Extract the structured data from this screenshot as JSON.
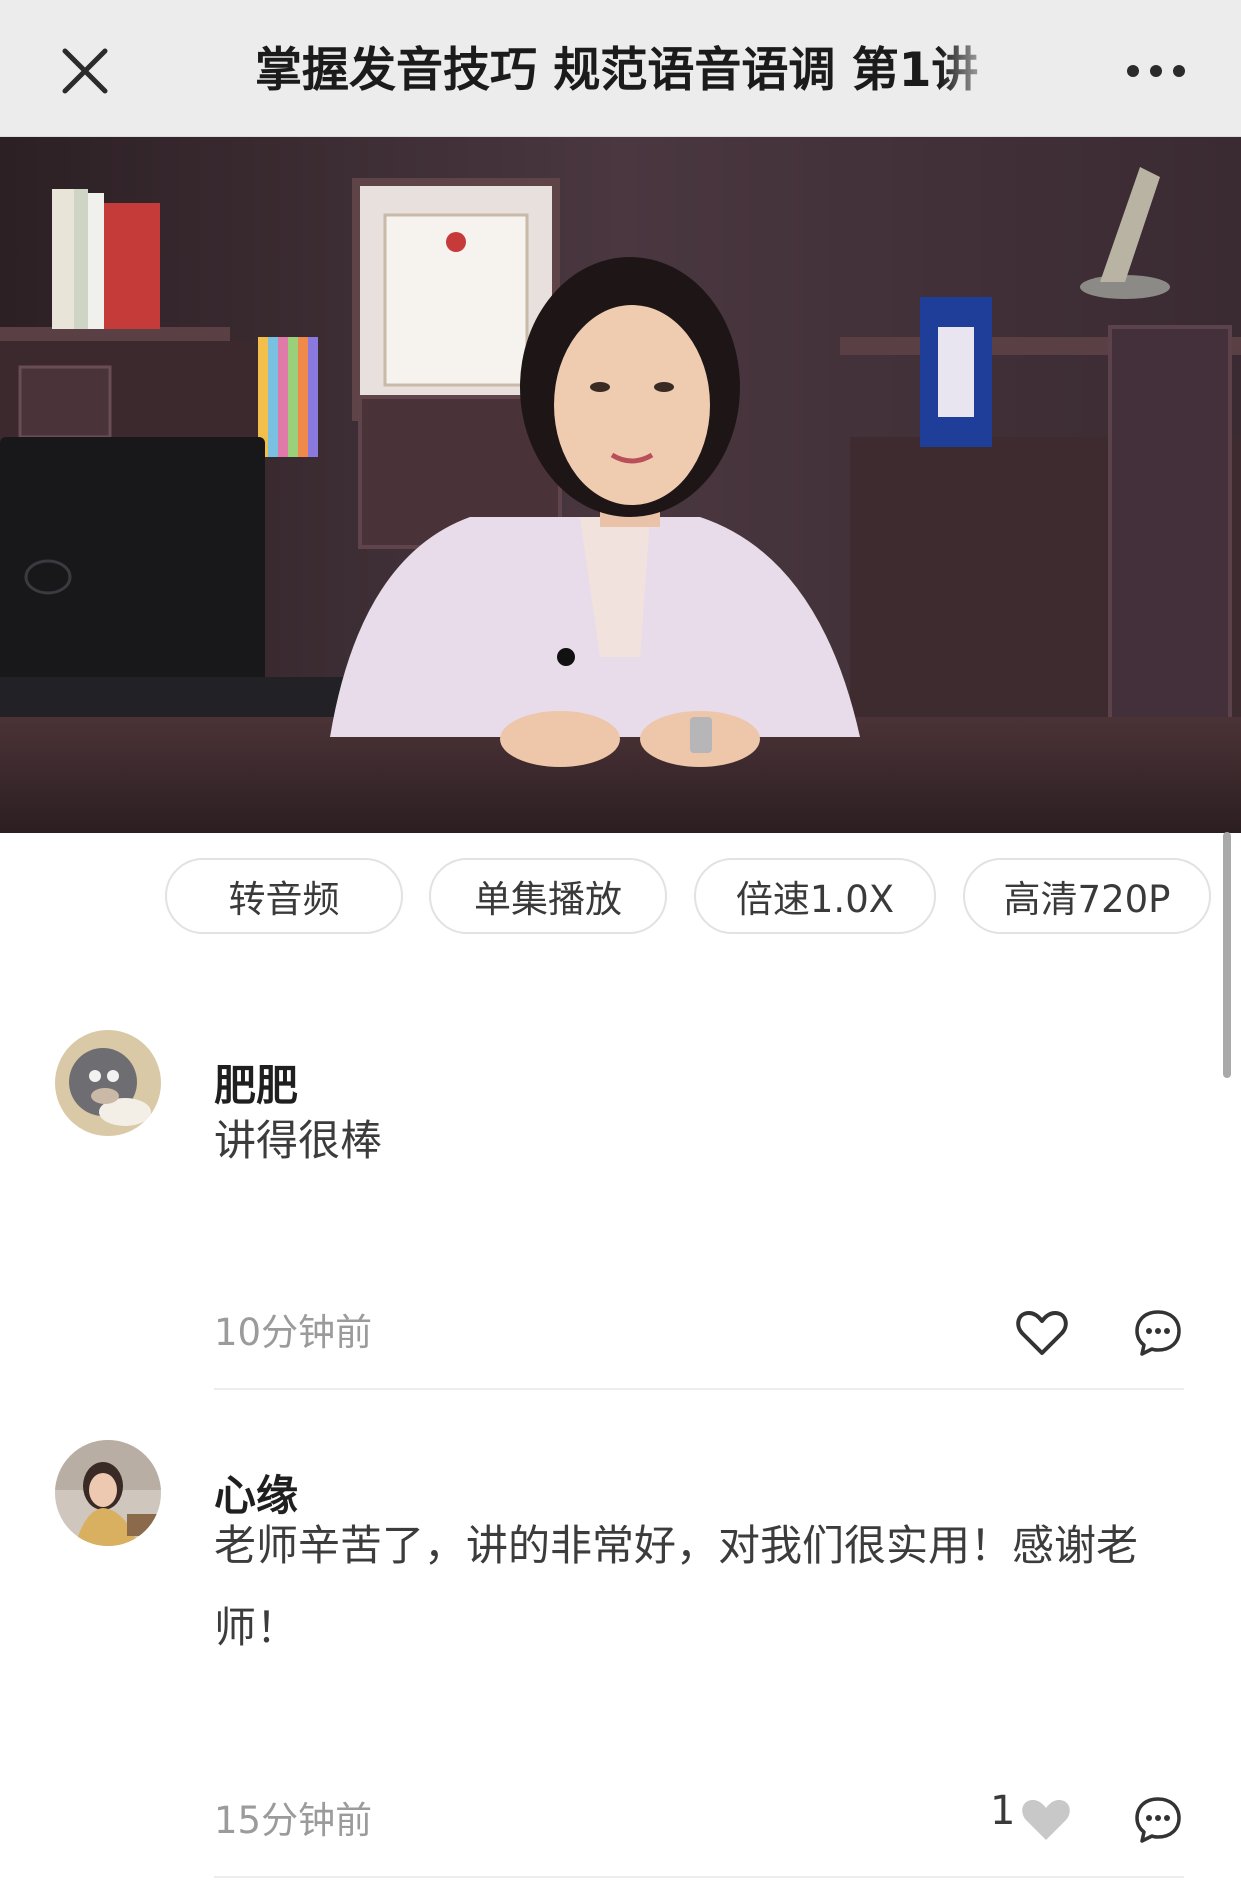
{
  "header": {
    "title": "掌握发音技巧 规范语音语调 第1讲",
    "close_icon": "close-icon",
    "more_icon": "more-horizontal-icon"
  },
  "options": [
    {
      "label": "转音频"
    },
    {
      "label": "单集播放"
    },
    {
      "label": "倍速1.0X"
    },
    {
      "label": "高清720P"
    }
  ],
  "comments": [
    {
      "name": "肥肥",
      "text": "讲得很棒",
      "time": "10分钟前",
      "likes": "",
      "liked": false
    },
    {
      "name": "心缘",
      "text": "老师辛苦了，讲的非常好，对我们很实用！感谢老师！",
      "time": "15分钟前",
      "likes": "1",
      "liked": true
    }
  ],
  "colors": {
    "header_bg": "#ececec",
    "chip_border": "#e2e2e2",
    "muted_text": "#9b9b9b",
    "liked_heart": "#c8c8c8"
  }
}
